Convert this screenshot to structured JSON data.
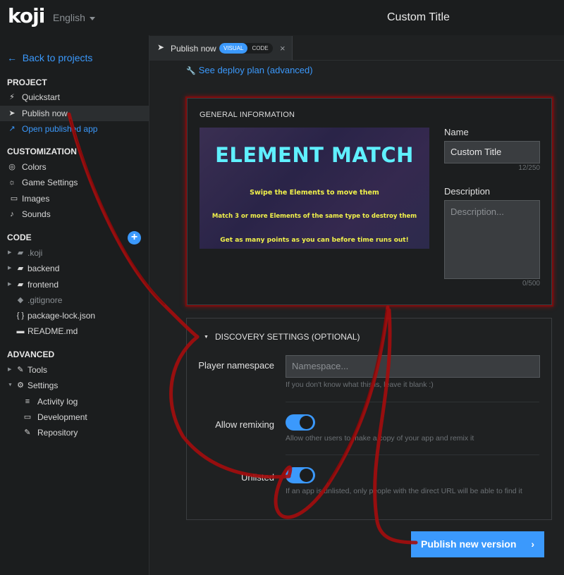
{
  "header": {
    "logo": "koji",
    "language": "English",
    "app_title": "Custom Title"
  },
  "sidebar": {
    "back": "Back to projects",
    "project_heading": "PROJECT",
    "project_items": [
      {
        "icon": "⚡",
        "label": "Quickstart"
      },
      {
        "icon": "➤",
        "label": "Publish now"
      },
      {
        "icon": "↗",
        "label": "Open published app"
      }
    ],
    "customization_heading": "CUSTOMIZATION",
    "customization_items": [
      {
        "icon": "◎",
        "label": "Colors"
      },
      {
        "icon": "☼",
        "label": "Game Settings"
      },
      {
        "icon": "▭",
        "label": "Images"
      },
      {
        "icon": "♪",
        "label": "Sounds"
      }
    ],
    "code_heading": "CODE",
    "code_items": [
      {
        "icon": "▰",
        "label": ".koji"
      },
      {
        "icon": "▰",
        "label": "backend"
      },
      {
        "icon": "▰",
        "label": "frontend"
      },
      {
        "icon": "◆",
        "label": ".gitignore"
      },
      {
        "icon": "{ }",
        "label": "package-lock.json"
      },
      {
        "icon": "▬",
        "label": "README.md"
      }
    ],
    "advanced_heading": "ADVANCED",
    "advanced_items": [
      {
        "icon": "✎",
        "label": "Tools"
      },
      {
        "icon": "⚙",
        "label": "Settings"
      },
      {
        "icon": "≡",
        "label": "Activity log"
      },
      {
        "icon": "▭",
        "label": "Development"
      },
      {
        "icon": "✎",
        "label": "Repository"
      }
    ]
  },
  "tab": {
    "label": "Publish now",
    "visual": "VISUAL",
    "code": "CODE",
    "close": "×"
  },
  "main": {
    "deploy_link": "See deploy plan (advanced)",
    "general": {
      "heading": "GENERAL INFORMATION",
      "preview": {
        "title": "ELEMENT MATCH",
        "line1": "Swipe the Elements to move them",
        "line2": "Match 3 or more Elements of the same type to destroy them",
        "line3": "Get as many points as you can before time runs out!"
      },
      "name_label": "Name",
      "name_value": "Custom Title",
      "name_counter": "12/250",
      "description_label": "Description",
      "description_placeholder": "Description...",
      "description_counter": "0/500"
    },
    "discovery": {
      "heading": "DISCOVERY SETTINGS (OPTIONAL)",
      "namespace_label": "Player namespace",
      "namespace_placeholder": "Namespace...",
      "namespace_hint": "If you don't know what this is, leave it blank :)",
      "remix_label": "Allow remixing",
      "remix_on": true,
      "remix_hint": "Allow other users to make a copy of your app and remix it",
      "unlisted_label": "Unlisted",
      "unlisted_on": true,
      "unlisted_hint": "If an app is unlisted, only people with the direct URL will be able to find it"
    },
    "publish_button": "Publish new version"
  },
  "colors": {
    "accent": "#3b99fc",
    "annotation": "#a50d0d",
    "preview_title": "#5ff0ff",
    "preview_text": "#f2f24a"
  }
}
